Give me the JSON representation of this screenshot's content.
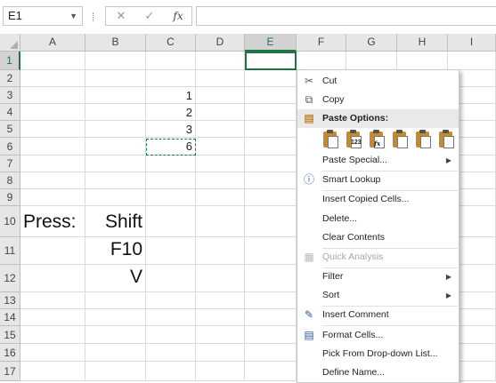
{
  "formula_bar": {
    "name_box": "E1",
    "cancel_glyph": "✕",
    "enter_glyph": "✓",
    "fx_label": "fx",
    "formula_value": ""
  },
  "columns": [
    "A",
    "B",
    "C",
    "D",
    "E",
    "F",
    "G",
    "H",
    "I"
  ],
  "rows": [
    "1",
    "2",
    "3",
    "4",
    "5",
    "6",
    "7",
    "8",
    "9",
    "10",
    "11",
    "12",
    "13",
    "14",
    "15",
    "16",
    "17"
  ],
  "cells": {
    "C3": "1",
    "C4": "2",
    "C5": "3",
    "C6": "6",
    "A10": "Press:",
    "B10": "Shift",
    "B11": "F10",
    "B12": "V"
  },
  "context_menu": {
    "items": [
      {
        "label": "Cut",
        "icon": "scissors-icon"
      },
      {
        "label": "Copy",
        "icon": "copy-icon"
      },
      {
        "label": "Paste Options:",
        "icon": "paste-icon"
      },
      {
        "label": "Paste Special...",
        "submenu": true
      },
      {
        "label": "Smart Lookup",
        "icon": "smart-lookup-icon"
      },
      {
        "label": "Insert Copied Cells..."
      },
      {
        "label": "Delete..."
      },
      {
        "label": "Clear Contents"
      },
      {
        "label": "Quick Analysis",
        "icon": "quick-analysis-icon",
        "disabled": true
      },
      {
        "label": "Filter",
        "submenu": true
      },
      {
        "label": "Sort",
        "submenu": true
      },
      {
        "label": "Insert Comment",
        "icon": "comment-icon"
      },
      {
        "label": "Format Cells...",
        "icon": "format-cells-icon"
      },
      {
        "label": "Pick From Drop-down List..."
      },
      {
        "label": "Define Name..."
      }
    ],
    "paste_options": [
      {
        "name": "paste-icon",
        "tag": ""
      },
      {
        "name": "paste-values-icon",
        "tag": "123"
      },
      {
        "name": "paste-formulas-icon",
        "tag": "fx"
      },
      {
        "name": "paste-transpose-icon",
        "tag": ""
      },
      {
        "name": "paste-formatting-icon",
        "tag": ""
      },
      {
        "name": "paste-link-icon",
        "tag": ""
      }
    ]
  },
  "colors": {
    "accent": "#217346",
    "header_bg": "#e6e6e6",
    "gridline": "#dadada"
  }
}
